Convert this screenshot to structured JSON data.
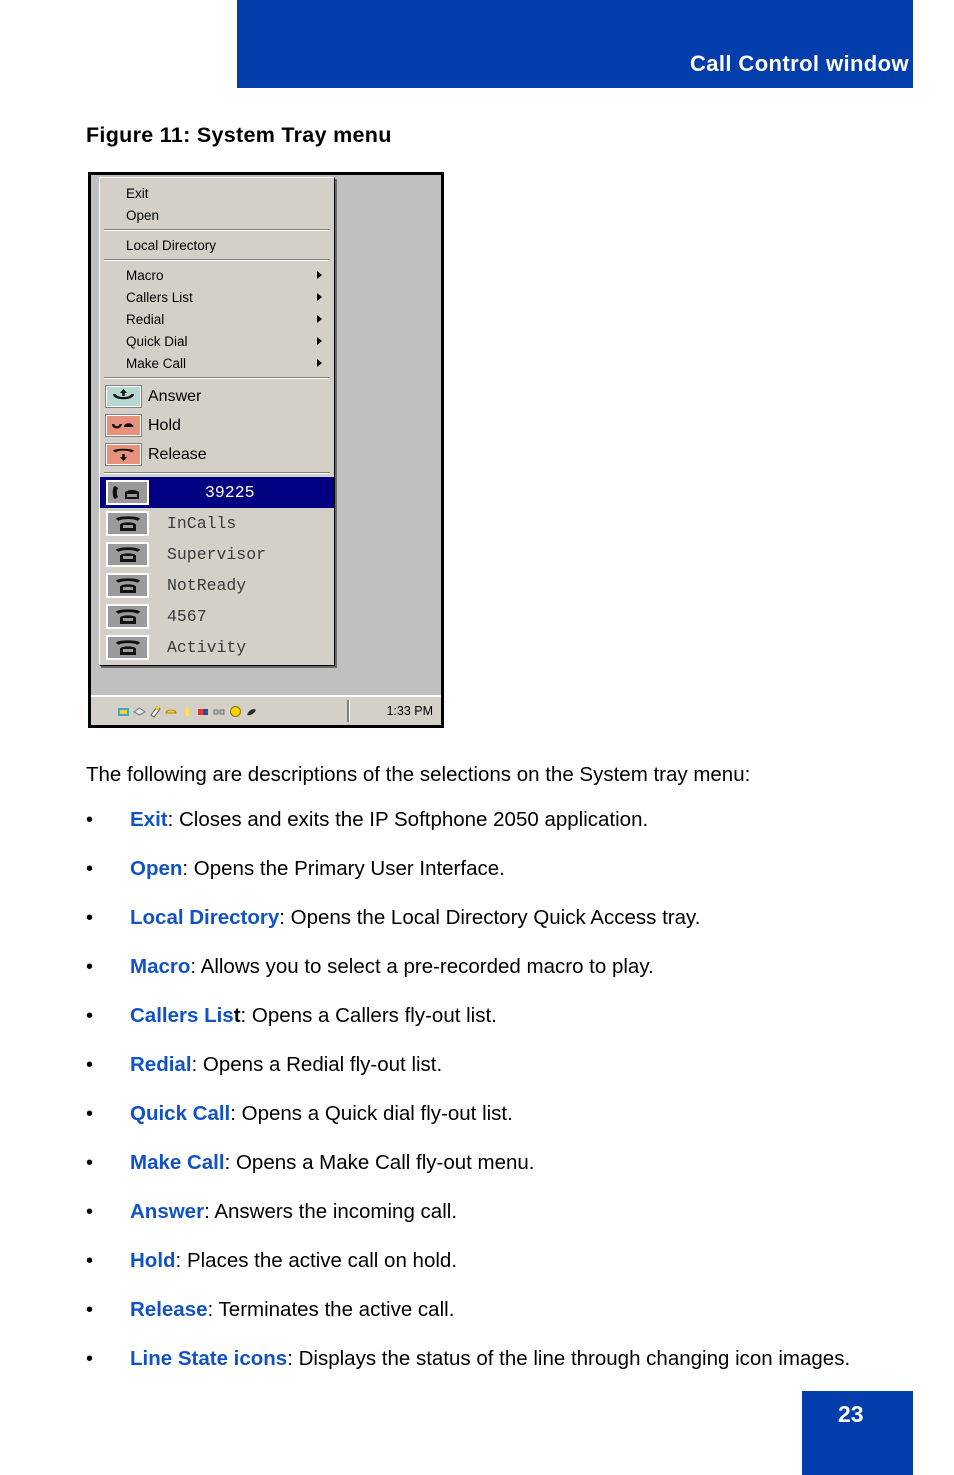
{
  "header": {
    "title": "Call Control window"
  },
  "figure": {
    "caption": "Figure 11: System Tray menu"
  },
  "tray_menu": {
    "commands": [
      {
        "label": "Exit"
      },
      {
        "label": "Open"
      }
    ],
    "directory": [
      {
        "label": "Local Directory"
      }
    ],
    "submenus": [
      {
        "label": "Macro",
        "arrow": "submenu-arrow-icon"
      },
      {
        "label": "Callers List",
        "arrow": "submenu-arrow-icon"
      },
      {
        "label": "Redial",
        "arrow": "submenu-arrow-icon"
      },
      {
        "label": "Quick Dial",
        "arrow": "submenu-arrow-icon"
      },
      {
        "label": "Make Call",
        "arrow": "submenu-arrow-icon"
      }
    ],
    "actions": [
      {
        "label": "Answer",
        "icon": "answer-handset-icon",
        "icon_bg": "#b7d8d2"
      },
      {
        "label": "Hold",
        "icon": "hold-handset-icon",
        "icon_bg": "#e8917c"
      },
      {
        "label": "Release",
        "icon": "release-handset-icon",
        "icon_bg": "#e8917c"
      }
    ],
    "line_states": [
      {
        "label": "39225",
        "icon": "offhook-phone-icon",
        "selected": true
      },
      {
        "label": "InCalls",
        "icon": "phone-icon",
        "selected": false
      },
      {
        "label": "Supervisor",
        "icon": "phone-icon",
        "selected": false
      },
      {
        "label": "NotReady",
        "icon": "phone-icon",
        "selected": false
      },
      {
        "label": "4567",
        "icon": "phone-icon",
        "selected": false
      },
      {
        "label": "Activity",
        "icon": "phone-icon",
        "selected": false
      }
    ]
  },
  "taskbar": {
    "clock": "1:33 PM",
    "tray_icon_colors": [
      "#3fa9c9",
      "#e8e8e8",
      "#f2d33c",
      "#ffd24a",
      "#ffe24a",
      "#d93b3b",
      "#bcbcbc",
      "#f5d200",
      "#2b2b2b"
    ]
  },
  "body": {
    "intro": "The following are descriptions of the selections on the System tray menu:",
    "bullet_char": "•",
    "bullets": [
      {
        "term": "Exit",
        "term_tail": "",
        "desc": ": Closes and exits the IP Softphone 2050 application."
      },
      {
        "term": "Open",
        "term_tail": "",
        "desc": ": Opens the Primary User Interface."
      },
      {
        "term": "Local Directory",
        "term_tail": "",
        "desc": ": Opens the Local Directory Quick Access tray."
      },
      {
        "term": "Macro",
        "term_tail": "",
        "desc": ": Allows you to select a pre-recorded macro to play."
      },
      {
        "term": "Callers Lis",
        "term_tail": "t",
        "desc": ": Opens a Callers fly-out list."
      },
      {
        "term": "Redial",
        "term_tail": "",
        "desc": ": Opens a Redial fly-out list."
      },
      {
        "term": "Quick Call",
        "term_tail": "",
        "desc": ": Opens a Quick dial fly-out list."
      },
      {
        "term": "Make Call",
        "term_tail": "",
        "desc": ": Opens a Make Call fly-out menu."
      },
      {
        "term": "Answer",
        "term_tail": "",
        "desc": ": Answers the incoming call."
      },
      {
        "term": "Hold",
        "term_tail": "",
        "desc": ": Places the active call on hold."
      },
      {
        "term": "Release",
        "term_tail": "",
        "desc": ": Terminates the active call."
      },
      {
        "term": "Line State icons",
        "term_tail": "",
        "desc": ": Displays the status of the line through changing icon images."
      }
    ]
  },
  "footer": {
    "page_number": "23"
  },
  "colors": {
    "brand_blue": "#043ead",
    "term_blue": "#1153c4",
    "menu_face": "#d4d0c8",
    "desktop_gray": "#c0c0c0",
    "selection_navy": "#000080"
  }
}
